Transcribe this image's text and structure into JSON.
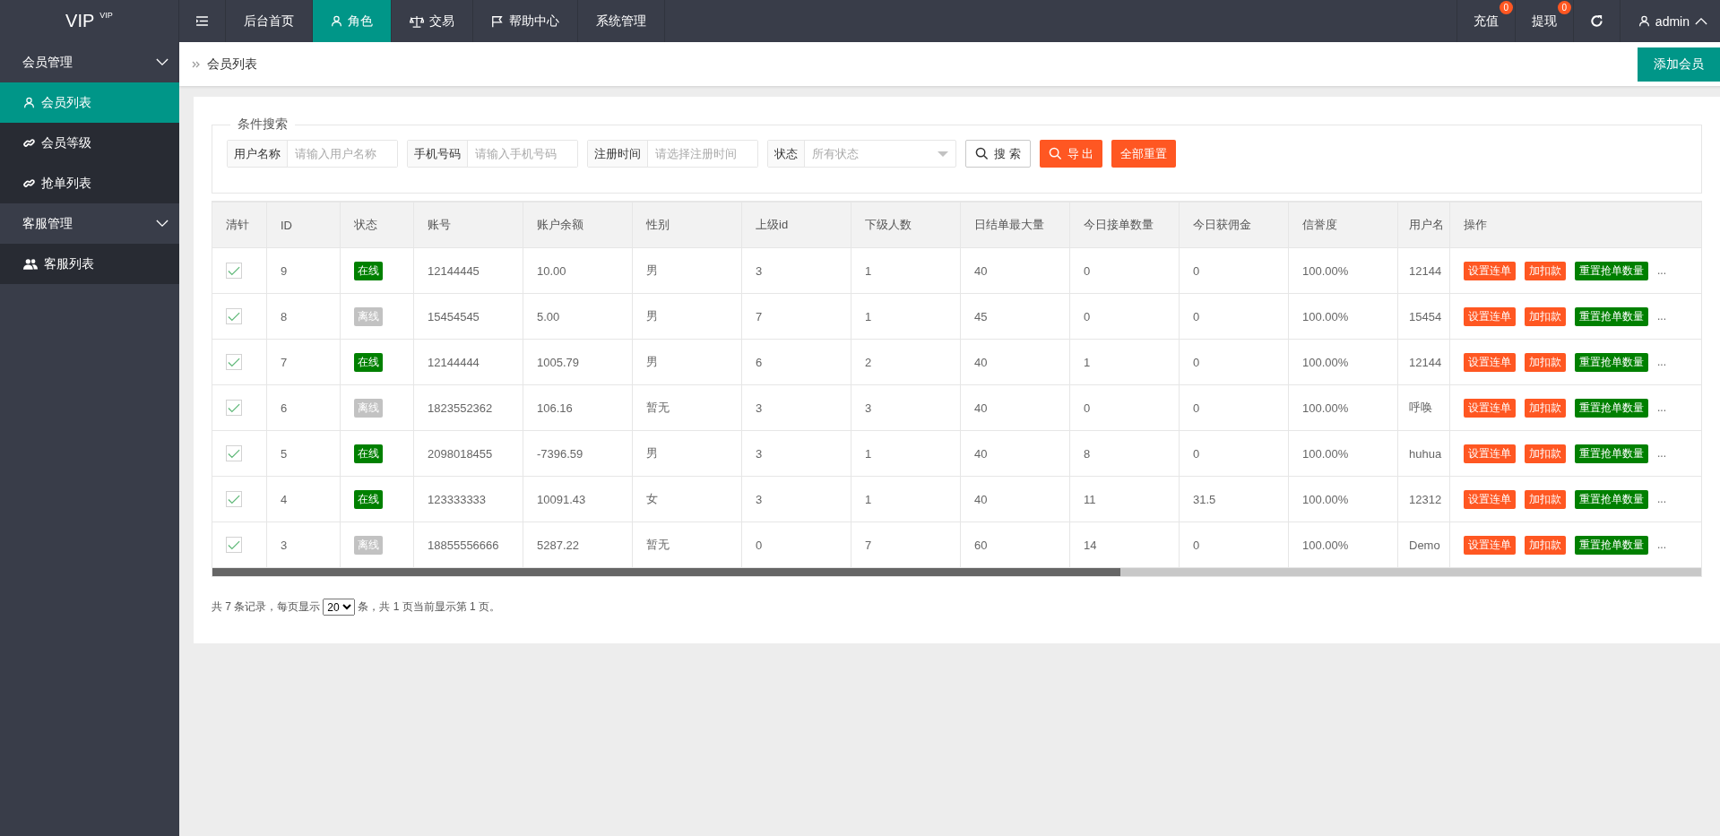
{
  "brand": {
    "title": "VIP",
    "sup": "VIP"
  },
  "nav": [
    {
      "kind": "plain",
      "label": "后台首页",
      "selected": false
    },
    {
      "kind": "person",
      "label": "角色",
      "selected": true
    },
    {
      "kind": "scale",
      "label": "交易",
      "selected": false
    },
    {
      "kind": "flag",
      "label": "帮助中心",
      "selected": false
    },
    {
      "kind": "plain",
      "label": "系统管理",
      "selected": false
    }
  ],
  "top_right": {
    "links": [
      {
        "label": "充值",
        "badge": "0"
      },
      {
        "label": "提现",
        "badge": "0"
      }
    ],
    "user": "admin"
  },
  "sidebar": [
    {
      "label": "会员管理",
      "expanded": true,
      "children": [
        {
          "kind": "person",
          "label": "会员列表",
          "selected": true
        },
        {
          "kind": "link",
          "label": "会员等级",
          "selected": false
        },
        {
          "kind": "link",
          "label": "抢单列表",
          "selected": false
        }
      ]
    },
    {
      "label": "客服管理",
      "expanded": true,
      "children": [
        {
          "kind": "group",
          "label": "客服列表",
          "selected": false
        }
      ]
    }
  ],
  "breadcrumb": "会员列表",
  "add_button": "添加会员",
  "search": {
    "legend": "条件搜索",
    "fields": [
      {
        "kind": "input",
        "label": "用户名称",
        "placeholder": "请输入用户名称"
      },
      {
        "kind": "input",
        "label": "手机号码",
        "placeholder": "请输入手机号码"
      },
      {
        "kind": "input",
        "label": "注册时间",
        "placeholder": "请选择注册时间"
      },
      {
        "kind": "select",
        "label": "状态",
        "placeholder": "所有状态"
      }
    ],
    "buttons": [
      {
        "kind": "outline",
        "label": "搜 索"
      },
      {
        "kind": "export",
        "label": "导 出"
      },
      {
        "kind": "plain",
        "label": "全部重置"
      }
    ]
  },
  "table": {
    "columns": [
      "清针",
      "ID",
      "状态",
      "账号",
      "账户余额",
      "性别",
      "上级id",
      "下级人数",
      "日结单最大量",
      "今日接单数量",
      "今日获佣金",
      "信誉度",
      "用户名",
      "操作"
    ],
    "actions": [
      [
        "设置连单",
        "加扣款",
        "重置抢单数量",
        "..."
      ],
      [
        "设置连单",
        "加扣款",
        "重置抢单数量",
        "..."
      ],
      [
        "设置连单",
        "加扣款",
        "重置抢单数量",
        "..."
      ],
      [
        "设置连单",
        "加扣款",
        "重置抢单数量",
        "..."
      ],
      [
        "设置连单",
        "加扣款",
        "重置抢单数量",
        "..."
      ],
      [
        "设置连单",
        "加扣款",
        "重置抢单数量",
        "..."
      ],
      [
        "设置连单",
        "加扣款",
        "重置抢单数量",
        "..."
      ]
    ],
    "rows": [
      {
        "checked": true,
        "id": "9",
        "online": true,
        "status": "在线",
        "account": "12144445",
        "balance": "10.00",
        "gender": "男",
        "parent_id": "3",
        "children": "1",
        "daily_max": "40",
        "today_orders": "0",
        "today_commission": "0",
        "credit": "100.00%",
        "username": "12144"
      },
      {
        "checked": true,
        "id": "8",
        "online": false,
        "status": "离线",
        "account": "15454545",
        "balance": "5.00",
        "gender": "男",
        "parent_id": "7",
        "children": "1",
        "daily_max": "45",
        "today_orders": "0",
        "today_commission": "0",
        "credit": "100.00%",
        "username": "15454"
      },
      {
        "checked": true,
        "id": "7",
        "online": true,
        "status": "在线",
        "account": "12144444",
        "balance": "1005.79",
        "gender": "男",
        "parent_id": "6",
        "children": "2",
        "daily_max": "40",
        "today_orders": "1",
        "today_commission": "0",
        "credit": "100.00%",
        "username": "12144"
      },
      {
        "checked": true,
        "id": "6",
        "online": false,
        "status": "离线",
        "account": "1823552362",
        "balance": "106.16",
        "gender": "暂无",
        "parent_id": "3",
        "children": "3",
        "daily_max": "40",
        "today_orders": "0",
        "today_commission": "0",
        "credit": "100.00%",
        "username": "呼唤"
      },
      {
        "checked": true,
        "id": "5",
        "online": true,
        "status": "在线",
        "account": "2098018455",
        "balance": "-7396.59",
        "gender": "男",
        "parent_id": "3",
        "children": "1",
        "daily_max": "40",
        "today_orders": "8",
        "today_commission": "0",
        "credit": "100.00%",
        "username": "huhua"
      },
      {
        "checked": true,
        "id": "4",
        "online": true,
        "status": "在线",
        "account": "123333333",
        "balance": "10091.43",
        "gender": "女",
        "parent_id": "3",
        "children": "1",
        "daily_max": "40",
        "today_orders": "11",
        "today_commission": "31.5",
        "credit": "100.00%",
        "username": "12312"
      },
      {
        "checked": true,
        "id": "3",
        "online": false,
        "status": "离线",
        "account": "18855556666",
        "balance": "5287.22",
        "gender": "暂无",
        "parent_id": "0",
        "children": "7",
        "daily_max": "60",
        "today_orders": "14",
        "today_commission": "0",
        "credit": "100.00%",
        "username": "Demo"
      }
    ]
  },
  "pagination": {
    "before": "共 7 条记录，每页显示",
    "page_size": "20",
    "after": "条，共 1 页当前显示第 1 页。"
  }
}
